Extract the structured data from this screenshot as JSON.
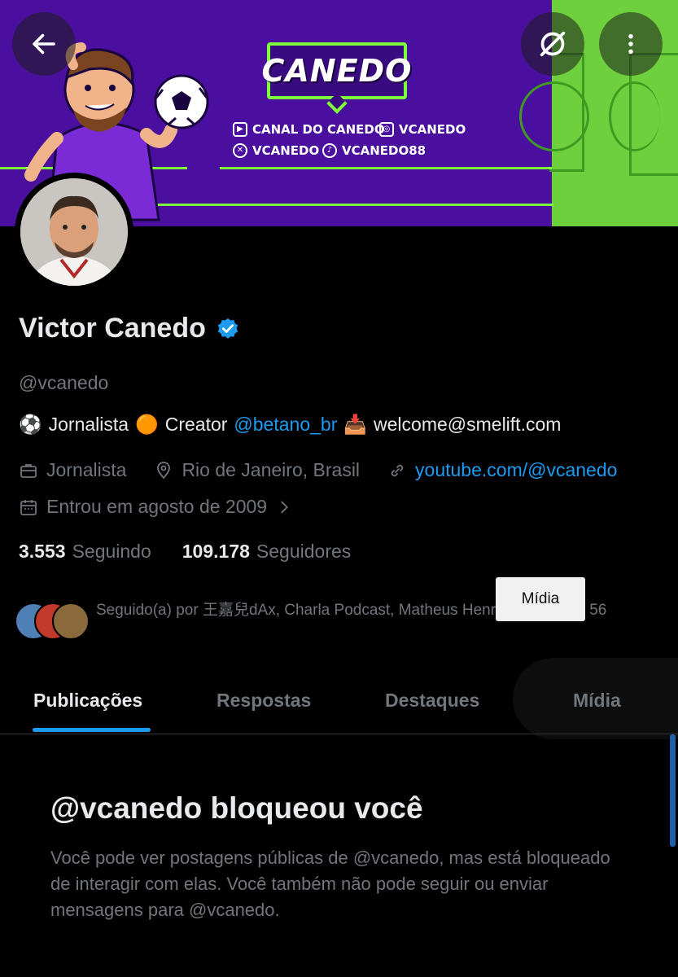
{
  "banner": {
    "logo_text": "CANEDO",
    "socials": [
      {
        "icon": "youtube-icon",
        "label": "CANAL DO CANEDO"
      },
      {
        "icon": "instagram-icon",
        "label": "VCANEDO"
      },
      {
        "icon": "x-icon",
        "label": "VCANEDO"
      },
      {
        "icon": "tiktok-icon",
        "label": "VCANEDO88"
      }
    ],
    "colors": {
      "purple": "#4a0f9e",
      "green": "#7cff3a",
      "pitch": "#6fd03e"
    }
  },
  "toolbar": {
    "back_icon": "back-arrow-icon",
    "grok_icon": "grok-icon",
    "more_icon": "more-vertical-icon"
  },
  "profile": {
    "name": "Victor Canedo",
    "verified_icon": "verified-badge-icon",
    "handle": "@vcanedo",
    "bio": {
      "emoji1": "⚽",
      "part1": "Jornalista",
      "emoji2": "🟠",
      "part2": "Creator",
      "mention": "@betano_br",
      "emoji3": "📥",
      "email": "welcome@smelift.com"
    },
    "profession": "Jornalista",
    "location": "Rio de Janeiro, Brasil",
    "website": "youtube.com/@vcanedo",
    "joined": "Entrou em agosto de 2009",
    "following_count": "3.553",
    "following_label": "Seguindo",
    "followers_count": "109.178",
    "followers_label": "Seguidores",
    "followed_by": "Seguido(a) por 王嘉兒dAx, Charla Podcast, Matheus Henrique e outros 56"
  },
  "tooltip": "Mídia",
  "tabs": [
    {
      "label": "Publicações",
      "active": true
    },
    {
      "label": "Respostas",
      "active": false
    },
    {
      "label": "Destaques",
      "active": false
    },
    {
      "label": "Mídia",
      "active": false
    }
  ],
  "blocked": {
    "title": "@vcanedo bloqueou você",
    "text": "Você pode ver postagens públicas de @vcanedo, mas está bloqueado de interagir com elas. Você também não pode seguir ou enviar mensagens para @vcanedo."
  },
  "colors": {
    "accent": "#1d9bf0",
    "muted": "#71767b",
    "text": "#e7e9ea",
    "background": "#000000"
  }
}
